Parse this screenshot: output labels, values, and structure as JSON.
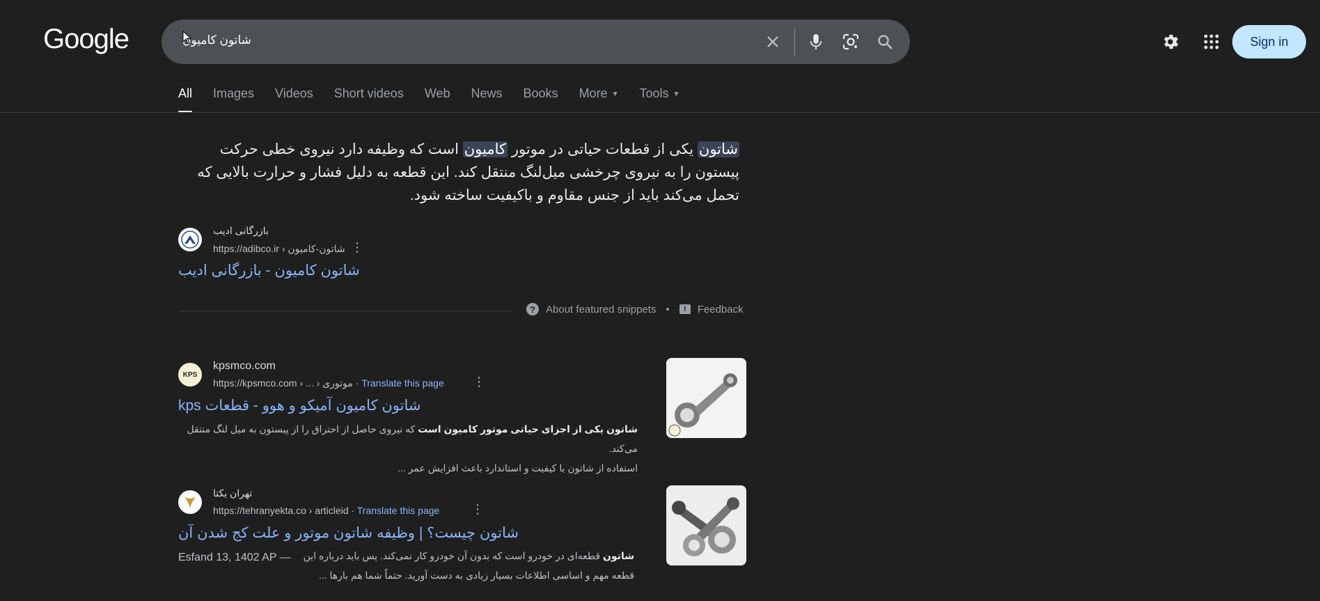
{
  "header": {
    "logo": "Google",
    "search_query": "شاتون کامیون",
    "sign_in": "Sign in"
  },
  "tabs": [
    {
      "label": "All"
    },
    {
      "label": "Images"
    },
    {
      "label": "Videos"
    },
    {
      "label": "Short videos"
    },
    {
      "label": "Web"
    },
    {
      "label": "News"
    },
    {
      "label": "Books"
    },
    {
      "label": "More"
    },
    {
      "label": "Tools"
    }
  ],
  "featured": {
    "hl1": "شاتون",
    "text1": " یکی از قطعات حیاتی در موتور ",
    "hl2": "کامیون",
    "text2": " است که وظیفه دارد نیروی خطی حرکت پیستون را به نیروی چرخشی میل‌لنگ منتقل کند. این قطعه به دلیل فشار و حرارت بالایی که تحمل می‌کند باید از جنس مقاوم و باکیفیت ساخته شود.",
    "site_name": "بازرگانی ادیب",
    "url": "https://adibco.ir › شاتون-کامیون",
    "title": "شاتون کامیون - بازرگانی ادیب",
    "about": "About featured snippets",
    "dot": "•",
    "feedback": "Feedback"
  },
  "results": [
    {
      "site_name": "kpsmco.com",
      "favicon_text": "KPS",
      "url": "https://kpsmco.com › ... › موتوری",
      "translate": "Translate this page",
      "title": "شاتون کامیون آمیکو و هوو - قطعات kps",
      "desc_bold1": "شاتون یکی از اجزای حیاتی موتور کامیون است",
      "desc_rest1": " که نیروی حاصل از احتراق را از پیستون به میل لنگ منتقل می‌کند.",
      "desc_line2": "استفاده از شاتون با کیفیت و استاندارد باعث افزایش عمر ..."
    },
    {
      "site_name": "تهران یکتا",
      "url": "https://tehranyekta.co › articleid",
      "translate": "Translate this page",
      "title": "شاتون چیست؟ | وظیفه شاتون موتور و علت کج شدن آن",
      "date": "Esfand 13, 1402 AP —",
      "desc_bold1": "شاتون",
      "desc_rest1": " قطعه‌ای در خودرو است که بدون آن خودرو کار نمی‌کند. پس باید درباره این",
      "desc_line2": "قطعه مهم و اساسی اطلاعات بسیار زیادی به دست آورید. حتماً شما هم بارها ..."
    }
  ]
}
